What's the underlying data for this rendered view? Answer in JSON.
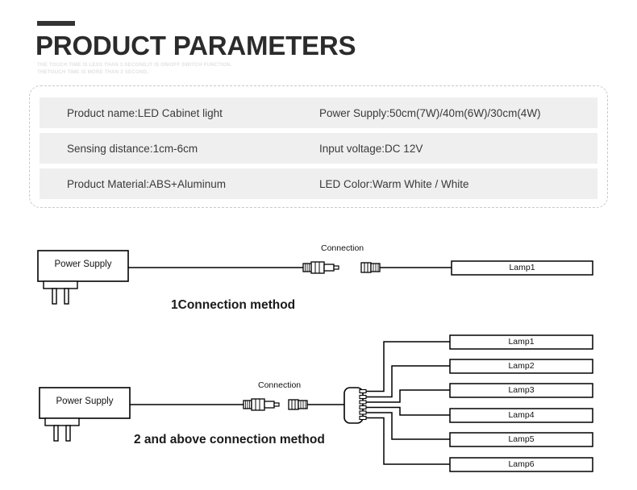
{
  "header": {
    "title": "PRODUCT PARAMETERS",
    "subtitle_line1": "THE TOUCH TIME IS LESS THAN 3 SECOND,IT IS ON/OFF SWITCH FUNCTION.",
    "subtitle_line2": "THETOUCH TIME IS MORE THAN 3 SECOND,",
    "accent_color": "#333333"
  },
  "spec_table": {
    "rows": [
      {
        "left": "Product name:LED Cabinet light",
        "right": "Power Supply:50cm(7W)/40m(6W)/30cm(4W)"
      },
      {
        "left": "Sensing distance:1cm-6cm",
        "right": "Input voltage:DC 12V"
      },
      {
        "left": "Product Material:ABS+Aluminum",
        "right": "LED Color:Warm White / White"
      }
    ],
    "row_background": "#efefef",
    "border_color": "#c9c9c9"
  },
  "diagram_1": {
    "caption": "1Connection method",
    "power_supply_label": "Power Supply",
    "connection_label": "Connection",
    "lamps": [
      "Lamp1"
    ]
  },
  "diagram_2": {
    "caption": "2 and above connection method",
    "power_supply_label": "Power Supply",
    "connection_label": "Connection",
    "splitter_ports": 6,
    "lamps": [
      "Lamp1",
      "Lamp2",
      "Lamp3",
      "Lamp4",
      "Lamp5",
      "Lamp6"
    ]
  },
  "style": {
    "line_color": "#000000",
    "text_color": "#111111"
  }
}
